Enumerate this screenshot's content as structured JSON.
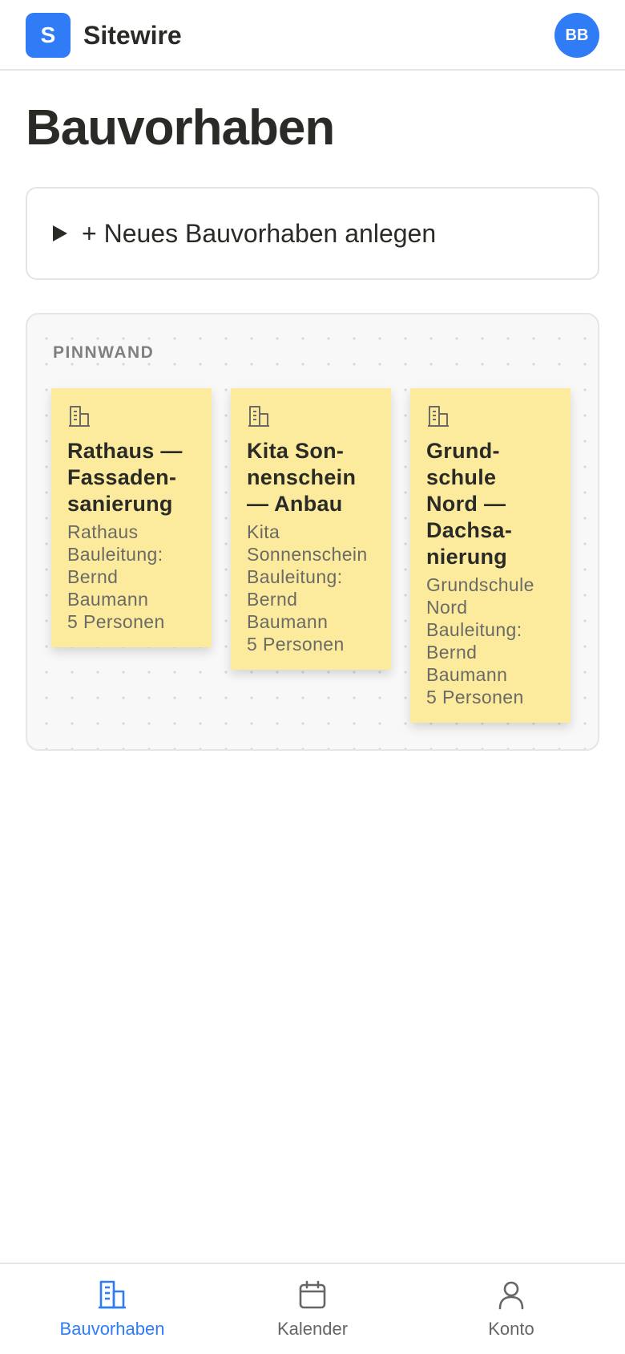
{
  "header": {
    "logo_letter": "S",
    "app_name": "Sitewire",
    "avatar_initials": "BB"
  },
  "page": {
    "title": "Bauvorhaben"
  },
  "new_project": {
    "label": "+ Neues Bauvorhaben anlegen"
  },
  "pinboard": {
    "label": "PINNWAND",
    "notes": [
      {
        "title": "Rathaus — Fassaden-sanierung",
        "title_lines": [
          "Rathaus —",
          "Fassaden-",
          "sanierung"
        ],
        "meta_lines": [
          "Rathaus",
          "Bauleitung:",
          "Bernd",
          "Baumann",
          "5 Personen"
        ]
      },
      {
        "title": "Kita Son-nenschein — Anbau",
        "title_lines": [
          "Kita Son-",
          "nenschein",
          "— Anbau"
        ],
        "meta_lines": [
          "Kita",
          "Sonnenschein",
          "Bauleitung:",
          "Bernd",
          "Baumann",
          "5 Personen"
        ]
      },
      {
        "title": "Grund-schule Nord — Dachsa-nierung",
        "title_lines": [
          "Grund-",
          "schule",
          "Nord —",
          "Dachsa-",
          "nierung"
        ],
        "meta_lines": [
          "Grundschule",
          "Nord",
          "Bauleitung:",
          "Bernd",
          "Baumann",
          "5 Personen"
        ]
      }
    ]
  },
  "bottom_nav": {
    "items": [
      {
        "label": "Bauvorhaben",
        "icon": "building-icon",
        "active": true
      },
      {
        "label": "Kalender",
        "icon": "calendar-icon",
        "active": false
      },
      {
        "label": "Konto",
        "icon": "user-icon",
        "active": false
      }
    ]
  },
  "colors": {
    "accent": "#2f7cf6",
    "note_yellow": "#fdeb9d",
    "text_dark": "#2a2a26",
    "text_muted": "#6a6a66"
  }
}
